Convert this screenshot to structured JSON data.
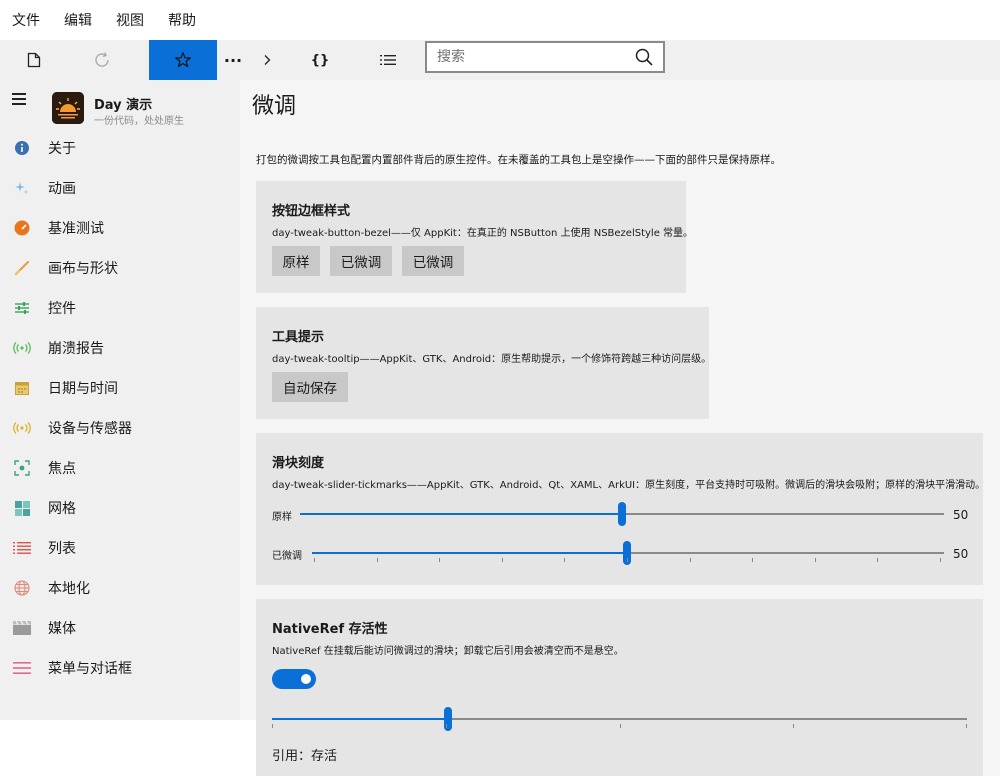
{
  "menu": [
    "文件",
    "编辑",
    "视图",
    "帮助"
  ],
  "search": {
    "placeholder": "搜索"
  },
  "toolbar": {
    "more": "···",
    "braces": "{}"
  },
  "app": {
    "title": "Day 演示",
    "subtitle": "一份代码，处处原生"
  },
  "nav": [
    {
      "label": "关于",
      "icon": "info-icon",
      "color": "#3a6fb0"
    },
    {
      "label": "动画",
      "icon": "sparkle-icon",
      "color": "#7fb7e6"
    },
    {
      "label": "基准测试",
      "icon": "gauge-icon",
      "color": "#e8761b"
    },
    {
      "label": "画布与形状",
      "icon": "brush-icon",
      "color": "#e8a040"
    },
    {
      "label": "控件",
      "icon": "sliders-icon",
      "color": "#3aa35a"
    },
    {
      "label": "崩溃报告",
      "icon": "broadcast-icon",
      "color": "#5abf5a"
    },
    {
      "label": "日期与时间",
      "icon": "calendar-icon",
      "color": "#c8a13a"
    },
    {
      "label": "设备与传感器",
      "icon": "sensor-icon",
      "color": "#e0b030"
    },
    {
      "label": "焦点",
      "icon": "focus-icon",
      "color": "#3aa37a"
    },
    {
      "label": "网格",
      "icon": "grid-icon",
      "color": "#4aa3a0"
    },
    {
      "label": "列表",
      "icon": "list-icon",
      "color": "#e0504a"
    },
    {
      "label": "本地化",
      "icon": "globe-icon",
      "color": "#e08a7a"
    },
    {
      "label": "媒体",
      "icon": "clapper-icon",
      "color": "#9a9a9a"
    },
    {
      "label": "菜单与对话框",
      "icon": "menu-lines-icon",
      "color": "#e06a8a"
    }
  ],
  "page": {
    "title": "微调",
    "description": "打包的微调按工具包配置内置部件背后的原生控件。在未覆盖的工具包上是空操作——下面的部件只是保持原样。"
  },
  "cards": {
    "bezel": {
      "title": "按钮边框样式",
      "desc": "day-tweak-button-bezel——仅 AppKit：在真正的 NSButton 上使用 NSBezelStyle 常量。",
      "buttons": [
        "原样",
        "已微调",
        "已微调"
      ]
    },
    "tooltip": {
      "title": "工具提示",
      "desc": "day-tweak-tooltip——AppKit、GTK、Android：原生帮助提示，一个修饰符跨越三种访问层级。",
      "button": "自动保存"
    },
    "slider": {
      "title": "滑块刻度",
      "desc": "day-tweak-slider-tickmarks——AppKit、GTK、Android、Qt、XAML、ArkUI：原生刻度，平台支持时可吸附。微调后的滑块会吸附；原样的滑块平滑滑动。",
      "rows": [
        {
          "label": "原样",
          "value": "50",
          "level": 0.5
        },
        {
          "label": "已微调",
          "value": "50",
          "level": 0.5
        }
      ]
    },
    "nativeref": {
      "title": "NativeRef 存活性",
      "desc": "NativeRef 在挂载后能访问微调过的滑块；卸载它后引用会被清空而不是悬空。",
      "toggle_on": true,
      "slider_level": 0.25,
      "status": "引用：存活"
    }
  },
  "colors": {
    "accent": "#0a6fd6",
    "sidebar_bg": "#f0f0f0",
    "card_bg": "#e5e5e5"
  }
}
